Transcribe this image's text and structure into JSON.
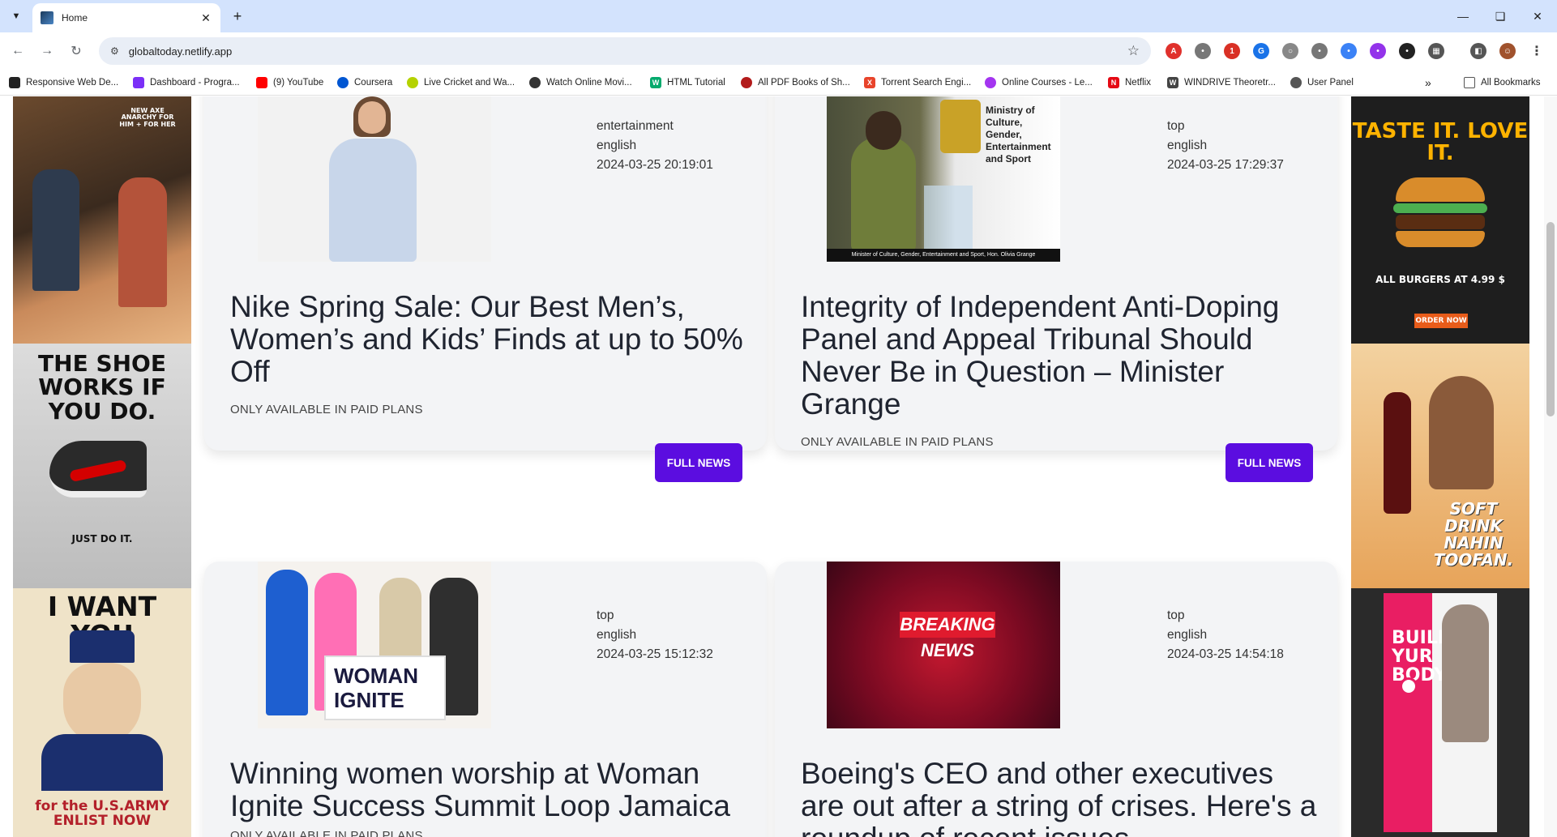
{
  "browser": {
    "tab_title": "Home",
    "url": "globaltoday.netlify.app",
    "bookmarks": [
      {
        "label": "Responsive Web De...",
        "color": "#222222"
      },
      {
        "label": "Dashboard - Progra...",
        "color": "#7b2ff7"
      },
      {
        "label": "(9) YouTube",
        "color": "#ff0000"
      },
      {
        "label": "Coursera",
        "color": "#0056d2"
      },
      {
        "label": "Live Cricket and Wa...",
        "color": "#b5d200"
      },
      {
        "label": "Watch Online Movi...",
        "color": "#333333"
      },
      {
        "label": "HTML Tutorial",
        "color": "#04aa6d"
      },
      {
        "label": "All PDF Books of Sh...",
        "color": "#b31b1b"
      },
      {
        "label": "Torrent Search Engi...",
        "color": "#e8442b"
      },
      {
        "label": "Online Courses - Le...",
        "color": "#a435f0"
      },
      {
        "label": "Netflix",
        "color": "#e50914"
      },
      {
        "label": "WINDRIVE Theoretr...",
        "color": "#444444"
      },
      {
        "label": "User Panel",
        "color": "#555555"
      }
    ],
    "all_bookmarks_label": "All Bookmarks",
    "icons": {
      "tab_list": "chevron-down-icon",
      "back": "back-arrow-icon",
      "forward": "forward-arrow-icon",
      "reload": "reload-icon",
      "bookmark_star": "star-icon"
    }
  },
  "ads": {
    "left": [
      {
        "text": "NEW AXE ANARCHY FOR HIM + FOR HER"
      },
      {
        "text": "THE SHOE WORKS IF YOU DO.",
        "sub": "JUST DO IT."
      },
      {
        "text": "I WANT YOU",
        "sub": "for the U.S.ARMY ENLIST NOW"
      }
    ],
    "right": [
      {
        "text": "TASTE IT. LOVE IT.",
        "sub": "ALL BURGERS AT 4.99 $",
        "cta": "ORDER NOW"
      },
      {
        "text": "SOFT DRINK NAHIN TOOFAN."
      },
      {
        "text": "BUILD YUR BODY"
      }
    ]
  },
  "news": [
    {
      "category": "entertainment",
      "language": "english",
      "published": "2024-03-25 20:19:01",
      "title": "Nike Spring Sale: Our Best Men’s, Women’s and Kids’ Finds at up to 50% Off",
      "description": "ONLY AVAILABLE IN PAID PLANS",
      "button": "FULL NEWS"
    },
    {
      "category": "top",
      "language": "english",
      "published": "2024-03-25 17:29:37",
      "title": "Integrity of Independent Anti-Doping Panel and Appeal Tribunal Should Never Be in Question – Minister Grange",
      "description": "ONLY AVAILABLE IN PAID PLANS",
      "button": "FULL NEWS",
      "image_caption": "Minister of Culture, Gender, Entertainment and Sport, Hon. Olivia Grange",
      "image_banner": "Ministry of Culture, Gender, Entertainment and Sport"
    },
    {
      "category": "top",
      "language": "english",
      "published": "2024-03-25 15:12:32",
      "title": "Winning women worship at Woman Ignite Success Summit Loop Jamaica",
      "description": "ONLY AVAILABLE IN PAID PLANS",
      "image_banner": "WOMAN IGNITE"
    },
    {
      "category": "top",
      "language": "english",
      "published": "2024-03-25 14:54:18",
      "title": "Boeing's CEO and other executives are out after a string of crises. Here's a roundup of recent issues",
      "image_banner": "BREAKING NEWS"
    }
  ]
}
